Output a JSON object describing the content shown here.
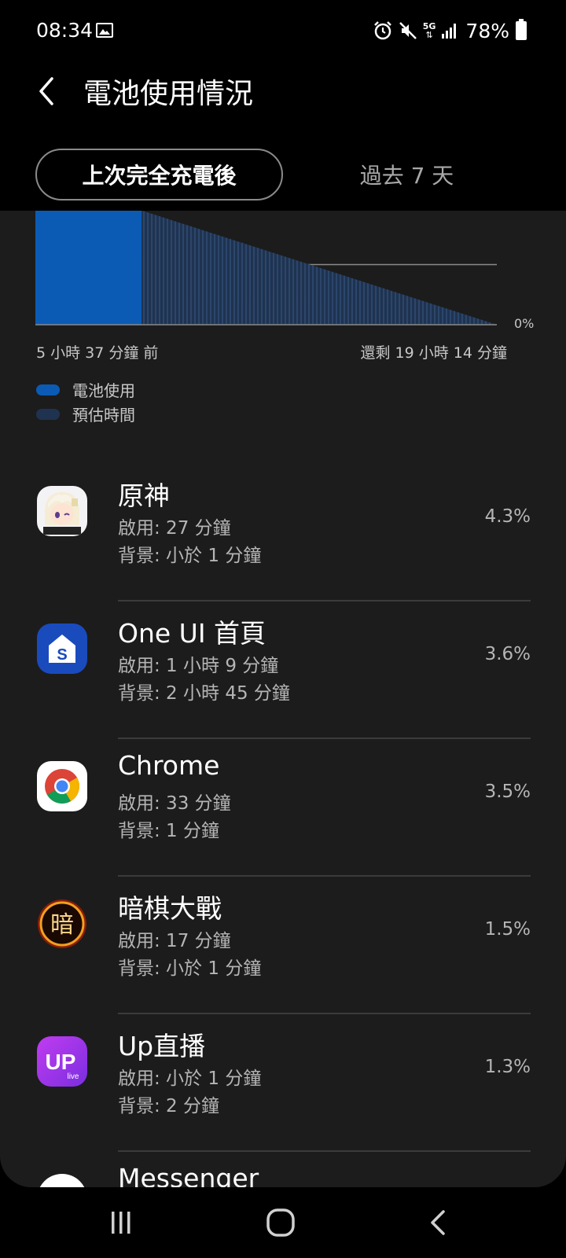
{
  "status_bar": {
    "time": "08:34",
    "battery_text": "78%",
    "signal_tech": "5G"
  },
  "header": {
    "title": "電池使用情況"
  },
  "tabs": [
    {
      "label": "上次完全充電後",
      "active": true
    },
    {
      "label": "過去 7 天",
      "active": false
    }
  ],
  "chart": {
    "left_label": "5 小時 37 分鐘 前",
    "right_label": "還剩 19 小時 14 分鐘",
    "zero_label": "0%"
  },
  "chart_data": {
    "type": "area",
    "series": [
      {
        "name": "電池使用",
        "color": "#0b5bb5",
        "x": [
          0,
          0.18,
          0.2,
          0.23
        ],
        "y": [
          100,
          100,
          98,
          95
        ]
      },
      {
        "name": "預估時間",
        "color": "#1f3350",
        "x": [
          0.23,
          1.0
        ],
        "y": [
          95,
          0
        ]
      }
    ],
    "gridline_y": [
      50
    ]
  },
  "legend": [
    {
      "label": "電池使用",
      "color": "#0b5bb5"
    },
    {
      "label": "預估時間",
      "color": "#1f3350"
    }
  ],
  "apps": [
    {
      "name": "原神",
      "active": "啟用: 27 分鐘",
      "background": "背景: 小於 1 分鐘",
      "percent": "4.3%",
      "icon": "genshin-icon"
    },
    {
      "name": "One UI 首頁",
      "active": "啟用: 1 小時 9 分鐘",
      "background": "背景: 2 小時 45 分鐘",
      "percent": "3.6%",
      "icon": "oneui-home-icon"
    },
    {
      "name": "Chrome",
      "active": "啟用: 33 分鐘",
      "background": "背景: 1 分鐘",
      "percent": "3.5%",
      "icon": "chrome-icon"
    },
    {
      "name": "暗棋大戰",
      "active": "啟用: 17 分鐘",
      "background": "背景: 小於 1 分鐘",
      "percent": "1.5%",
      "icon": "dark-chess-icon"
    },
    {
      "name": "Up直播",
      "active": "啟用: 小於 1 分鐘",
      "background": "背景: 2 分鐘",
      "percent": "1.3%",
      "icon": "uplive-icon"
    },
    {
      "name": "Messenger",
      "active": "",
      "background": "",
      "percent": "",
      "icon": "messenger-icon"
    }
  ],
  "icons": {
    "oneui_letter": "S",
    "dark_chess_char": "暗",
    "up_text": "UP",
    "up_sub": "live"
  }
}
